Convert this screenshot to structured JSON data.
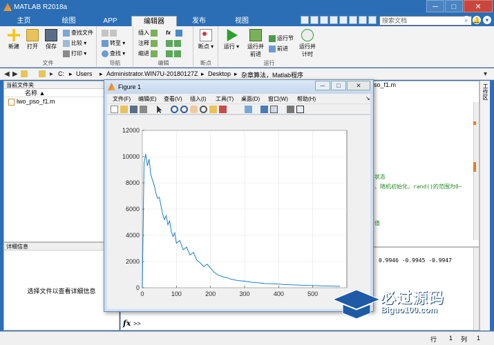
{
  "window": {
    "title": "MATLAB R2018a"
  },
  "tabs": [
    "主页",
    "绘图",
    "APP",
    "编辑器",
    "发布",
    "视图"
  ],
  "search": {
    "placeholder": "搜索文档"
  },
  "ribbon": {
    "file_group": {
      "label": "文件",
      "new": "新建",
      "open": "打开",
      "save": "保存",
      "find_files": "查找文件",
      "compare": "比较",
      "print": "打印"
    },
    "nav_group": {
      "label": "导航",
      "goto": "转至",
      "find": "查找"
    },
    "edit_group": {
      "label": "编辑",
      "insert": "插入",
      "comment": "注释",
      "indent": "缩进",
      "fx": "fx"
    },
    "breakpoint_group": {
      "label": "断点",
      "breakpoints": "断点"
    },
    "run_group": {
      "label": "运行",
      "run": "运行",
      "run_advance": "运行并\n前进",
      "run_section": "运行节",
      "advance": "前进",
      "run_time": "运行并\n计时"
    }
  },
  "path": [
    "C:",
    "Users",
    "Administrator.WIN7U-20180127Z",
    "Desktop",
    "杂章算法，Matlab程序"
  ],
  "current_folder": {
    "title": "当前文件夹",
    "column": "名称 ▲",
    "files": [
      "lwo_pso_f1.m"
    ]
  },
  "details": {
    "title": "详细信息",
    "message": "选择文件以查看详细信息"
  },
  "editor": {
    "tab": "pso_f1.m",
    "lines": [
      "状态",
      "、随机初始化，rand()的范围为0~",
      "值"
    ]
  },
  "workspace_title": "工作区",
  "command_window": {
    "output": "0.9946    -0.9945    -0.9947",
    "prompt": ">>"
  },
  "statusbar": {
    "row_label": "行",
    "row": "1",
    "col_label": "列",
    "col": "1"
  },
  "figure": {
    "title": "Figure 1",
    "menu": [
      "文件(F)",
      "编辑(E)",
      "查看(V)",
      "插入(I)",
      "工具(T)",
      "桌面(D)",
      "窗口(W)",
      "帮助(H)"
    ]
  },
  "watermark": {
    "main": "必过源码",
    "sub": "Biguo100.com"
  },
  "chart_data": {
    "type": "line",
    "title": "",
    "xlabel": "",
    "ylabel": "",
    "xlim": [
      0,
      600
    ],
    "ylim": [
      0,
      12000
    ],
    "xticks": [
      0,
      100,
      200,
      300,
      400,
      500
    ],
    "yticks": [
      0,
      2000,
      4000,
      6000,
      8000,
      10000,
      12000
    ],
    "grid": true,
    "series": [
      {
        "color": "#0072bd",
        "x": [
          0,
          5,
          10,
          15,
          20,
          25,
          30,
          35,
          40,
          45,
          50,
          55,
          60,
          65,
          70,
          75,
          80,
          85,
          90,
          95,
          100,
          110,
          120,
          130,
          140,
          150,
          160,
          170,
          180,
          190,
          200,
          210,
          220,
          230,
          240,
          250,
          260,
          280,
          300,
          320,
          340,
          360,
          380,
          400,
          420,
          440,
          460,
          480,
          500,
          520,
          540,
          560,
          580
        ],
        "y": [
          0,
          9500,
          10200,
          9300,
          9800,
          8600,
          8200,
          7800,
          7200,
          6800,
          6900,
          6200,
          5600,
          5200,
          5500,
          4800,
          5100,
          4300,
          3900,
          4200,
          3400,
          3600,
          2900,
          3100,
          2500,
          2700,
          2100,
          1900,
          1600,
          1800,
          1500,
          1200,
          1000,
          900,
          800,
          750,
          650,
          550,
          500,
          420,
          380,
          320,
          300,
          280,
          240,
          220,
          200,
          180,
          170,
          150,
          130,
          120,
          100
        ]
      }
    ]
  }
}
